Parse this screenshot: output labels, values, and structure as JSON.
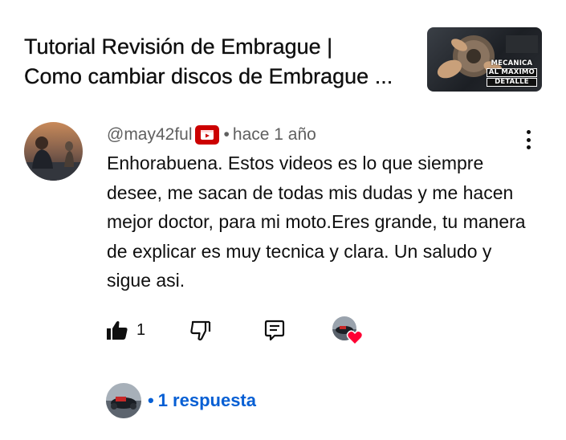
{
  "video": {
    "title_line1": "Tutorial Revisión de Embrague  |",
    "title_line2": "Como cambiar discos de Embrague ...",
    "thumbnail_text_line1": "MECANICA",
    "thumbnail_text_line2": "AL MAXIMO",
    "thumbnail_text_line3": "DETALLE"
  },
  "comment": {
    "author_handle": "@may42ful",
    "badge_icon": "membership-badge-icon",
    "separator": "•",
    "timestamp": "hace 1 año",
    "text": "Enhorabuena. Estos videos es lo que siempre desee, me sacan de todas mis dudas y me hacen mejor doctor, para mi moto.Eres grande, tu manera de explicar es muy tecnica y clara. Un saludo y sigue asi.",
    "like_count": "1",
    "creator_heart": true
  },
  "replies": {
    "dot": "•",
    "label": "1 respuesta"
  },
  "colors": {
    "text_primary": "#0f0f0f",
    "text_secondary": "#606060",
    "link_blue": "#065fd4",
    "badge_red": "#cc0000",
    "heart_red": "#ff0033"
  }
}
